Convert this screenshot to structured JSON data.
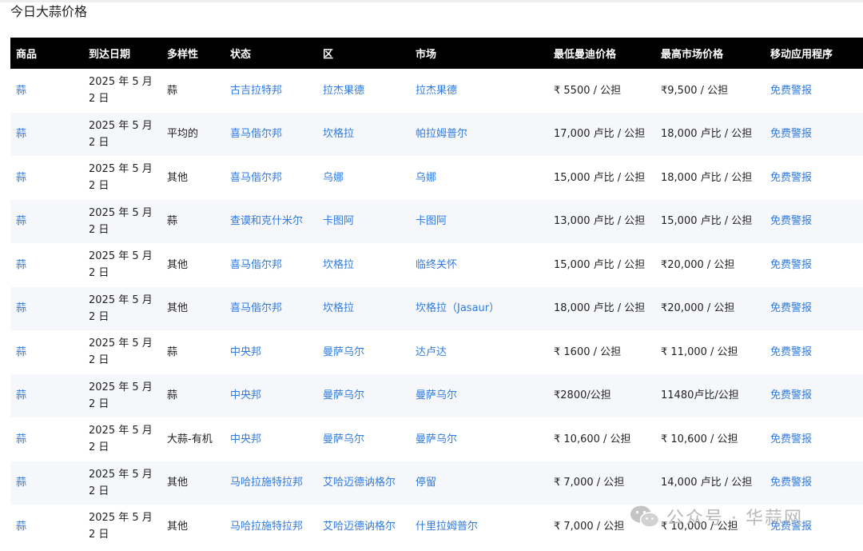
{
  "page": {
    "title": "今日大蒜价格"
  },
  "table": {
    "headers": [
      "商品",
      "到达日期",
      "多样性",
      "状态",
      "区",
      "市场",
      "最低曼迪价格",
      "最高市场价格",
      "移动应用程序"
    ],
    "rows": [
      {
        "commodity": "蒜",
        "date": "2025 年 5 月 2 日",
        "variety": "蒜",
        "state": "古吉拉特邦",
        "district": "拉杰果德",
        "market": "拉杰果德",
        "min_price": "₹ 5500 / 公担",
        "max_price": "₹9,500 / 公担",
        "app": "免费警报"
      },
      {
        "commodity": "蒜",
        "date": "2025 年 5 月 2 日",
        "variety": "平均的",
        "state": "喜马偕尔邦",
        "district": "坎格拉",
        "market": "帕拉姆普尔",
        "min_price": "17,000 卢比 / 公担",
        "max_price": "18,000 卢比 / 公担",
        "app": "免费警报"
      },
      {
        "commodity": "蒜",
        "date": "2025 年 5 月 2 日",
        "variety": "其他",
        "state": "喜马偕尔邦",
        "district": "乌娜",
        "market": "乌娜",
        "min_price": "15,000 卢比 / 公担",
        "max_price": "18,000 卢比 / 公担",
        "app": "免费警报"
      },
      {
        "commodity": "蒜",
        "date": "2025 年 5 月 2 日",
        "variety": "蒜",
        "state": "查谟和克什米尔",
        "district": "卡图阿",
        "market": "卡图阿",
        "min_price": "13,000 卢比 / 公担",
        "max_price": "15,000 卢比 / 公担",
        "app": "免费警报"
      },
      {
        "commodity": "蒜",
        "date": "2025 年 5 月 2 日",
        "variety": "其他",
        "state": "喜马偕尔邦",
        "district": "坎格拉",
        "market": "临终关怀",
        "min_price": "15,000 卢比 / 公担",
        "max_price": "₹20,000 / 公担",
        "app": "免费警报"
      },
      {
        "commodity": "蒜",
        "date": "2025 年 5 月 2 日",
        "variety": "其他",
        "state": "喜马偕尔邦",
        "district": "坎格拉",
        "market": "坎格拉（Jasaur）",
        "min_price": "18,000 卢比 / 公担",
        "max_price": "₹20,000 / 公担",
        "app": "免费警报"
      },
      {
        "commodity": "蒜",
        "date": "2025 年 5 月 2 日",
        "variety": "蒜",
        "state": "中央邦",
        "district": "曼萨乌尔",
        "market": "达卢达",
        "min_price": "₹ 1600 / 公担",
        "max_price": "₹ 11,000 / 公担",
        "app": "免费警报"
      },
      {
        "commodity": "蒜",
        "date": "2025 年 5 月 2 日",
        "variety": "蒜",
        "state": "中央邦",
        "district": "曼萨乌尔",
        "market": "曼萨乌尔",
        "min_price": "₹2800/公担",
        "max_price": "11480卢比/公担",
        "app": "免费警报"
      },
      {
        "commodity": "蒜",
        "date": "2025 年 5 月 2 日",
        "variety": "大蒜-有机",
        "state": "中央邦",
        "district": "曼萨乌尔",
        "market": "曼萨乌尔",
        "min_price": "₹ 10,600 / 公担",
        "max_price": "₹ 10,600 / 公担",
        "app": "免费警报"
      },
      {
        "commodity": "蒜",
        "date": "2025 年 5 月 2 日",
        "variety": "其他",
        "state": "马哈拉施特拉邦",
        "district": "艾哈迈德讷格尔",
        "market": "停留",
        "min_price": "₹ 7,000 / 公担",
        "max_price": "14,000 卢比 / 公担",
        "app": "免费警报"
      },
      {
        "commodity": "蒜",
        "date": "2025 年 5 月 2 日",
        "variety": "其他",
        "state": "马哈拉施特拉邦",
        "district": "艾哈迈德讷格尔",
        "market": "什里拉姆普尔",
        "min_price": "₹ 7,000 / 公担",
        "max_price": "₹ 10,000 / 公担",
        "app": "免费警报"
      }
    ]
  },
  "watermark": {
    "text": "公众号 · 华蒜网",
    "icon": "wechat-icon"
  }
}
